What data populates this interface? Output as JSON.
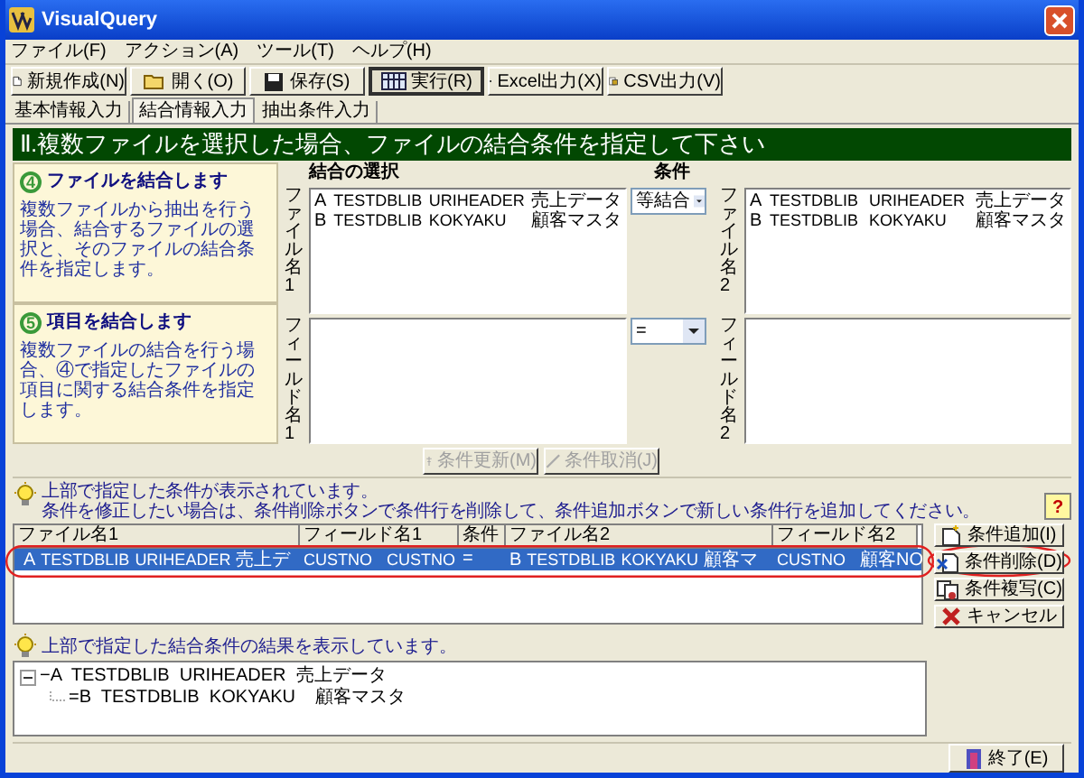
{
  "window": {
    "title": "VisualQuery"
  },
  "menu": [
    "ファイル(F)",
    "アクション(A)",
    "ツール(T)",
    "ヘルプ(H)"
  ],
  "toolbar": [
    {
      "label": "新規作成(N)",
      "kind": "new",
      "pressed": false
    },
    {
      "label": "開く(O)",
      "kind": "open",
      "pressed": false
    },
    {
      "label": "保存(S)",
      "kind": "save",
      "pressed": false
    },
    {
      "label": "実行(R)",
      "kind": "run",
      "pressed": true
    },
    {
      "label": "Excel出力(X)",
      "kind": "excel",
      "pressed": false
    },
    {
      "label": "CSV出力(V)",
      "kind": "csv",
      "pressed": false
    }
  ],
  "tabs": [
    {
      "label": "基本情報入力",
      "selected": false
    },
    {
      "label": "結合情報入力",
      "selected": true
    },
    {
      "label": "抽出条件入力",
      "selected": false
    }
  ],
  "header": "Ⅱ.複数ファイルを選択した場合、ファイルの結合条件を指定して下さい",
  "steps": [
    {
      "number": "4",
      "title": "ファイルを結合します",
      "text": "複数ファイルから抽出を行う場合、結合するファイルの選択と、そのファイルの結合条件を指定します。"
    },
    {
      "number": "5",
      "title": "項目を結合します",
      "text": "複数ファイルの結合を行う場合、④で指定したファイルの項目に関する結合条件を指定します。"
    }
  ],
  "join": {
    "heading": "結合の選択",
    "condition_heading": "条件",
    "file1_label": "ファイル名1",
    "field1_label": "フィールド名1",
    "file2_label": "ファイル名2",
    "field2_label": "フィールド名2",
    "files1": [
      {
        "id": "A",
        "library": "TESTDBLIB",
        "file": "URIHEADER",
        "description": "売上データ"
      },
      {
        "id": "B",
        "library": "TESTDBLIB",
        "file": "KOKYAKU",
        "description": "顧客マスタ"
      }
    ],
    "files2": [
      {
        "id": "A",
        "library": "TESTDBLIB",
        "file": "URIHEADER",
        "description": "売上データ"
      },
      {
        "id": "B",
        "library": "TESTDBLIB",
        "file": "KOKYAKU",
        "description": "顧客マスタ"
      }
    ],
    "join_type": "等結合",
    "operator": "="
  },
  "actions": [
    {
      "label": "条件更新(M)",
      "kind": "update",
      "disabled": true
    },
    {
      "label": "条件取消(J)",
      "kind": "undo",
      "disabled": true
    }
  ],
  "conditions_hint": [
    "上部で指定した条件が表示されています。",
    "条件を修正したい場合は、条件削除ボタンで条件行を削除して、条件追加ボタンで新しい条件行を追加してください。"
  ],
  "help_button": "?",
  "table": {
    "columns": [
      "ファイル名1",
      "フィールド名1",
      "条件",
      "ファイル名2",
      "フィールド名2"
    ],
    "rows": [
      {
        "selected": true,
        "file1": {
          "id": "A",
          "library": "TESTDBLIB",
          "file": "URIHEADER",
          "description": "売上デ"
        },
        "field1": {
          "field": "CUSTNO",
          "name": "CUSTNO"
        },
        "operator": "=",
        "file2": {
          "id": "B",
          "library": "TESTDBLIB",
          "file": "KOKYAKU",
          "description": "顧客マ"
        },
        "field2": {
          "field": "CUSTNO",
          "name": "顧客NO"
        }
      }
    ]
  },
  "side_buttons": [
    {
      "label": "条件追加(I)",
      "kind": "add"
    },
    {
      "label": "条件削除(D)",
      "kind": "delete"
    },
    {
      "label": "条件複写(C)",
      "kind": "copy"
    },
    {
      "label": "キャンセル",
      "kind": "cancel"
    }
  ],
  "result_hint": "上部で指定した結合条件の結果を表示しています。",
  "tree": [
    {
      "label": "−A  TESTDBLIB  URIHEADER  売上データ",
      "expanded": true,
      "children": [
        {
          "label": "=B  TESTDBLIB  KOKYAKU    顧客マスタ"
        }
      ]
    }
  ],
  "exit_button": "終了(E)"
}
